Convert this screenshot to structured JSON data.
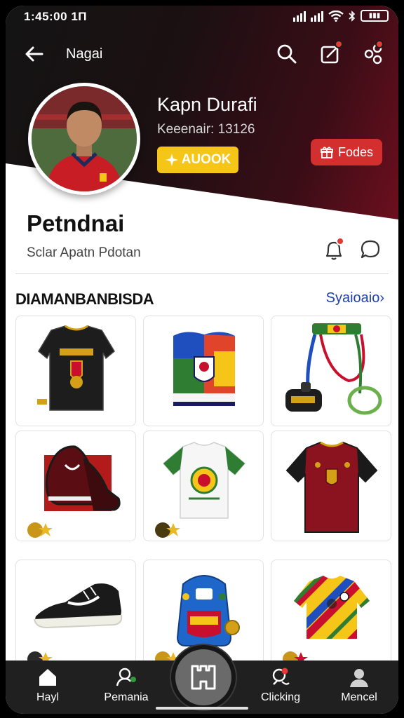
{
  "status_bar": {
    "time": "1:45:00 1Π",
    "battery": "▮▮▮"
  },
  "appbar": {
    "title": "Nagai"
  },
  "profile": {
    "name": "Kapn Durafi",
    "subtitle": "Keeenair: 13126",
    "badge_label": "AUOOK",
    "action_label": "Fodes"
  },
  "section": {
    "name": "Petndnai",
    "subtitle": "Sclar Apatn Pdotan"
  },
  "grid": {
    "title": "DIAMANBANBISDA",
    "link": "Syaioaio",
    "link_chevron": "›",
    "items": [
      {
        "name": "black-jersey-with-crest"
      },
      {
        "name": "patterned-banner-pennant"
      },
      {
        "name": "lanyard-with-keychain"
      },
      {
        "name": "red-sneakers"
      },
      {
        "name": "white-tshirt-with-emblem"
      },
      {
        "name": "red-jersey-with-badges"
      },
      {
        "name": "black-sneakers"
      },
      {
        "name": "blue-backpack"
      },
      {
        "name": "colorful-striped-shirt"
      }
    ]
  },
  "bottom_nav": {
    "items": [
      {
        "label": "Hayl",
        "icon": "home-icon"
      },
      {
        "label": "Pemania",
        "icon": "user-plus-icon"
      },
      {
        "label": "",
        "icon": "fab-center-icon"
      },
      {
        "label": "Clicking",
        "icon": "map-pin-icon"
      },
      {
        "label": "Mencel",
        "icon": "profile-icon"
      }
    ]
  },
  "colors": {
    "accent_red": "#d32f2f",
    "gold": "#f5c518",
    "link_blue": "#1f3fae",
    "nav_bg": "#202020"
  }
}
